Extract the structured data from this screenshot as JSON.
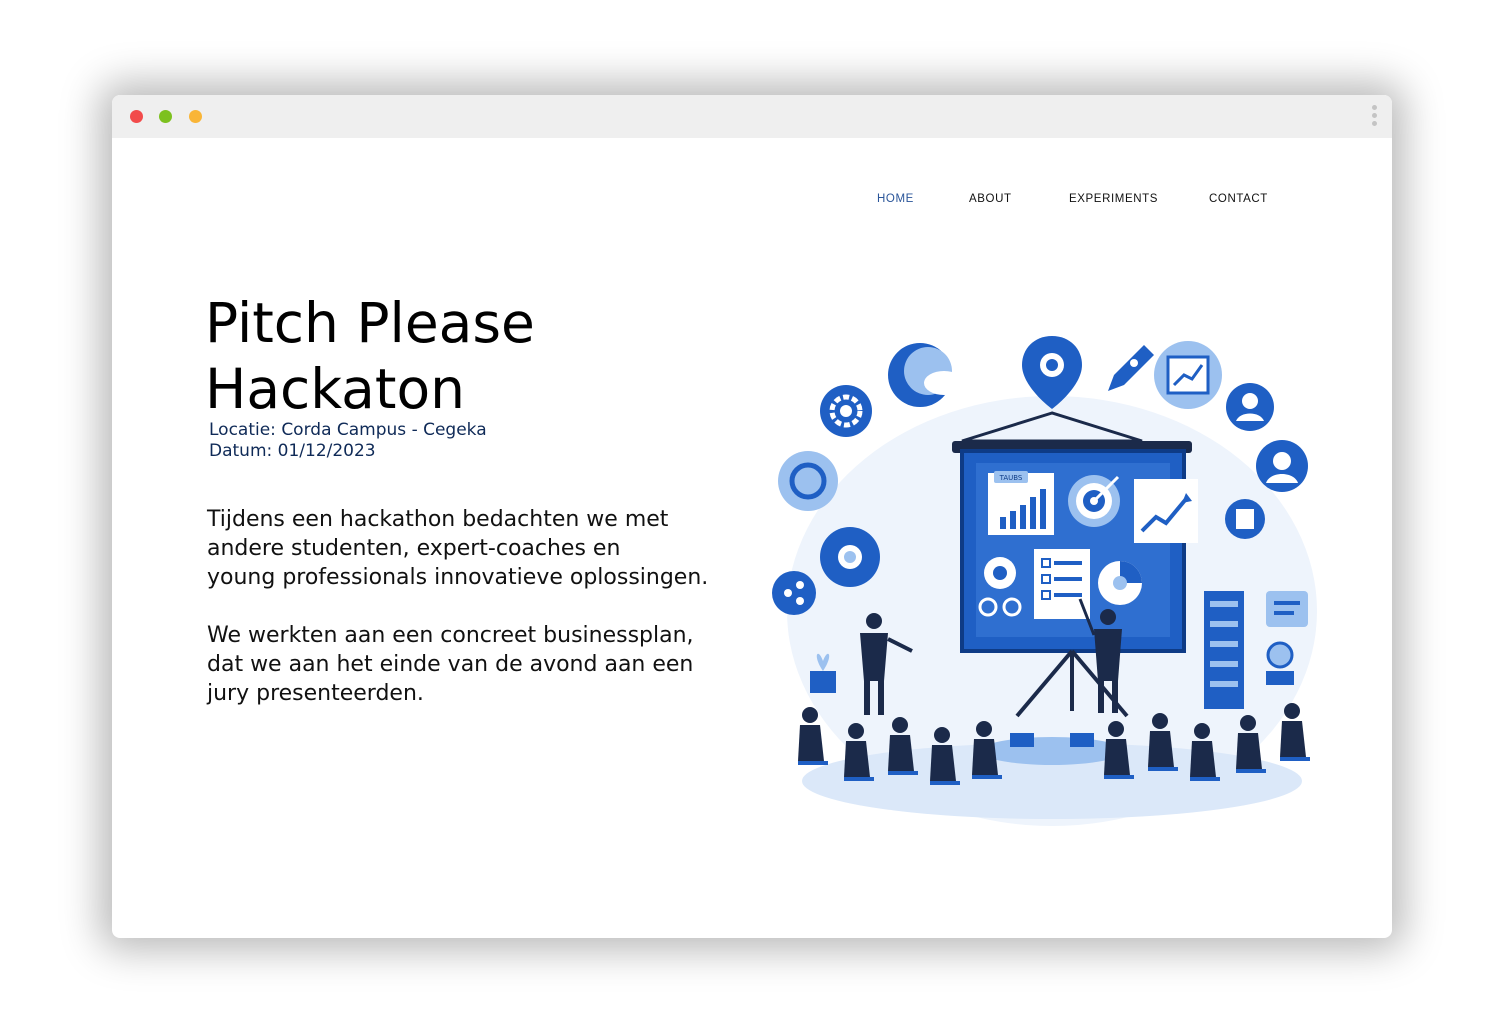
{
  "nav": {
    "home": "HOME",
    "about": "ABOUT",
    "experiments": "EXPERIMENTS",
    "contact": "CONTACT"
  },
  "hero": {
    "title_line1": "Pitch Please",
    "title_line2": "Hackaton",
    "location": "Locatie: Corda Campus - Cegeka",
    "date": "Datum: 01/12/2023",
    "paragraph1_line1": "Tijdens een hackathon bedachten we met",
    "paragraph1_line2": "andere studenten, expert-coaches en",
    "paragraph1_line3": "young professionals innovatieve oplossingen.",
    "paragraph2_line1": "We werkten aan een concreet businessplan,",
    "paragraph2_line2": "dat we aan het einde van de avond aan een",
    "paragraph2_line3": "jury presenteerden."
  },
  "illustration": {
    "screen_tag": "TAUBS",
    "accent_color": "#1f5fc4",
    "light_color": "#9cc1ef"
  }
}
